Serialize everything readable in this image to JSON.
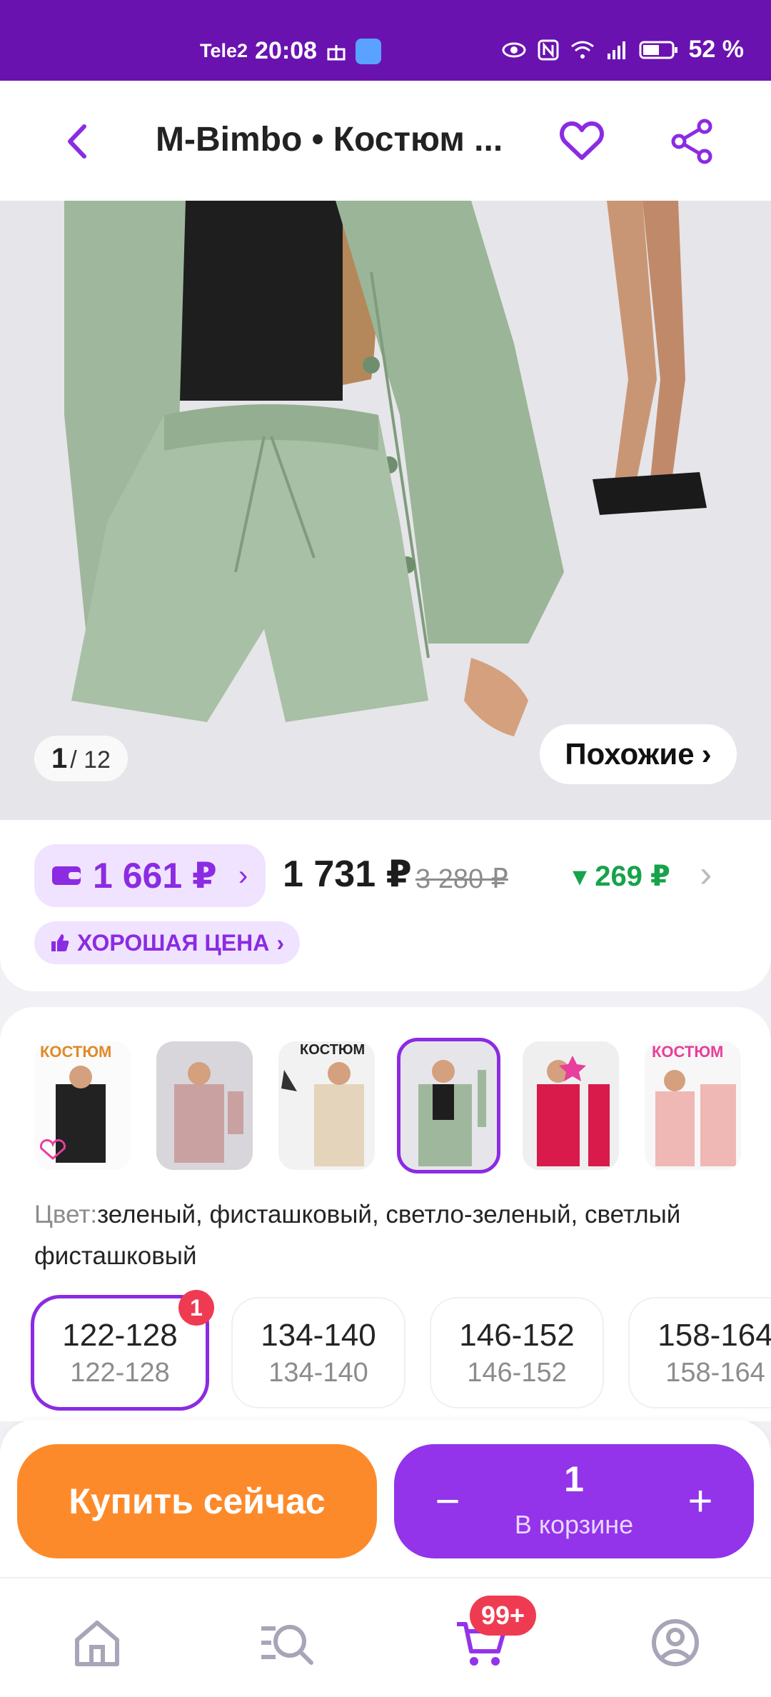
{
  "status_bar": {
    "carrier": "Tele2",
    "time": "20:08",
    "battery": "52 %"
  },
  "header": {
    "title": "M-Bimbo • Костюм ...",
    "icons": {
      "back": "chevron-left-icon",
      "favorite": "heart-icon",
      "share": "share-icon"
    }
  },
  "gallery": {
    "current": "1",
    "total": "/ 12",
    "similar_label": "Похожие",
    "similar_chevron": "›"
  },
  "price": {
    "wallet_price": "1 661 ₽",
    "wallet_chevron": "›",
    "price": "1 731 ₽",
    "old_price": "3 280 ₽",
    "discount": "▾ 269 ₽",
    "chevron": "›",
    "badge": "ХОРОШАЯ ЦЕНА",
    "badge_chevron": "›",
    "accent_color": "#8b2be2",
    "discount_color": "#16a34a"
  },
  "variants": {
    "thumb_texts": [
      "КОСТЮМ",
      "КОСТЮМ",
      "КОСТЮМ"
    ],
    "thumbs": [
      {
        "selected": false
      },
      {
        "selected": false
      },
      {
        "selected": false
      },
      {
        "selected": true
      },
      {
        "selected": false
      },
      {
        "selected": false
      }
    ],
    "color_label": "Цвет:",
    "color_value": "зеленый, фисташковый, светло-зеленый, светлый фисташковый",
    "sizes": [
      {
        "primary": "122-128",
        "secondary": "122-128",
        "badge": "1",
        "selected": true
      },
      {
        "primary": "134-140",
        "secondary": "134-140"
      },
      {
        "primary": "146-152",
        "secondary": "146-152"
      },
      {
        "primary": "158-164",
        "secondary": "158-164"
      }
    ]
  },
  "buy": {
    "buy_now": "Купить сейчас",
    "minus": "−",
    "plus": "+",
    "quantity": "1",
    "in_cart": "В корзине",
    "buy_color": "#fd8a2a",
    "cart_color": "#9333ea"
  },
  "bottom_nav": {
    "cart_badge": "99+",
    "items": [
      "home-icon",
      "catalog-search-icon",
      "cart-icon",
      "profile-icon"
    ]
  }
}
